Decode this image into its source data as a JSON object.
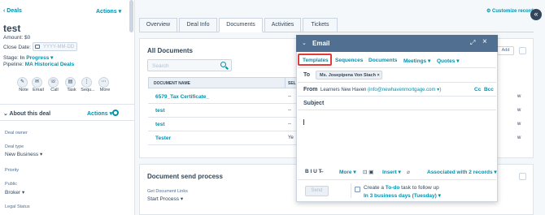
{
  "left": {
    "back_link": "‹ Deals",
    "actions_label": "Actions ▾",
    "deal_name": "test",
    "amount": "Amount: $0",
    "close_date_label": "Close Date:",
    "close_date_placeholder": "YYYY-MM-DD",
    "stage_label": "Stage:",
    "stage_value": "In Progress ▾",
    "pipeline_label": "Pipeline:",
    "pipeline_value": "MA Historical Deals",
    "action_buttons": [
      {
        "label": "Note",
        "icon": "note-icon",
        "glyph": "✎"
      },
      {
        "label": "Email",
        "icon": "email-icon",
        "glyph": "✉"
      },
      {
        "label": "Call",
        "icon": "call-icon",
        "glyph": "☏"
      },
      {
        "label": "Task",
        "icon": "task-icon",
        "glyph": "▤"
      },
      {
        "label": "Sequ...",
        "icon": "sequence-icon",
        "glyph": "⋮"
      },
      {
        "label": "More",
        "icon": "more-icon",
        "glyph": "⋯"
      }
    ],
    "about_header": "⌄  About this deal",
    "about_actions": "Actions ▾",
    "fields": [
      {
        "label": "Deal owner",
        "value": ""
      },
      {
        "label": "Deal type",
        "value": "New Business ▾"
      },
      {
        "label": "Priority",
        "value": ""
      },
      {
        "label": "Public",
        "value": "Broker ▾"
      },
      {
        "label": "Legal Status",
        "value": ""
      }
    ]
  },
  "header": {
    "customize": "⚙ Customize record",
    "tabs": [
      "Overview",
      "Deal Info",
      "Documents",
      "Activities",
      "Tickets"
    ],
    "active_tab": "Documents"
  },
  "documents": {
    "title": "All Documents",
    "search_placeholder": "Search",
    "add_label": "Add",
    "col_name": "DOCUMENT NAME",
    "col_sel": "SEL",
    "rows": [
      {
        "name": "6579_Tax Certificate_",
        "mid": "--",
        "right": "w"
      },
      {
        "name": "test",
        "mid": "--",
        "right": "w"
      },
      {
        "name": "test",
        "mid": "--",
        "right": "w"
      },
      {
        "name": "Tester",
        "mid": "Ye",
        "right": "w"
      }
    ]
  },
  "send_process": {
    "title": "Document send process",
    "label": "Get Document Links",
    "value": "Start Process ▾"
  },
  "email": {
    "title": "Email",
    "tabs": [
      "Templates",
      "Sequences",
      "Documents",
      "Meetings ▾",
      "Quotes ▾"
    ],
    "to_label": "To",
    "to_chip": "Ms. Josepipena Von Stach  ×",
    "from_label": "From",
    "from_name": "Learners New Haven",
    "from_email": "(info@newhavenmortgage.com ▾)",
    "cc": "Cc",
    "bcc": "Bcc",
    "subject_label": "Subject",
    "toolbar_format": "B  I  U  T̶",
    "more": "More ▾",
    "toolbar_icons": "⊡  ▣",
    "insert": "Insert ▾",
    "attach": "⌀",
    "associated": "Associated with 2 records ▾",
    "send": "Send",
    "todo_prefix": "Create a",
    "todo_link": "To-do",
    "todo_suffix": "task to follow up",
    "todo_when": "In 3 business days (Tuesday) ▾"
  }
}
